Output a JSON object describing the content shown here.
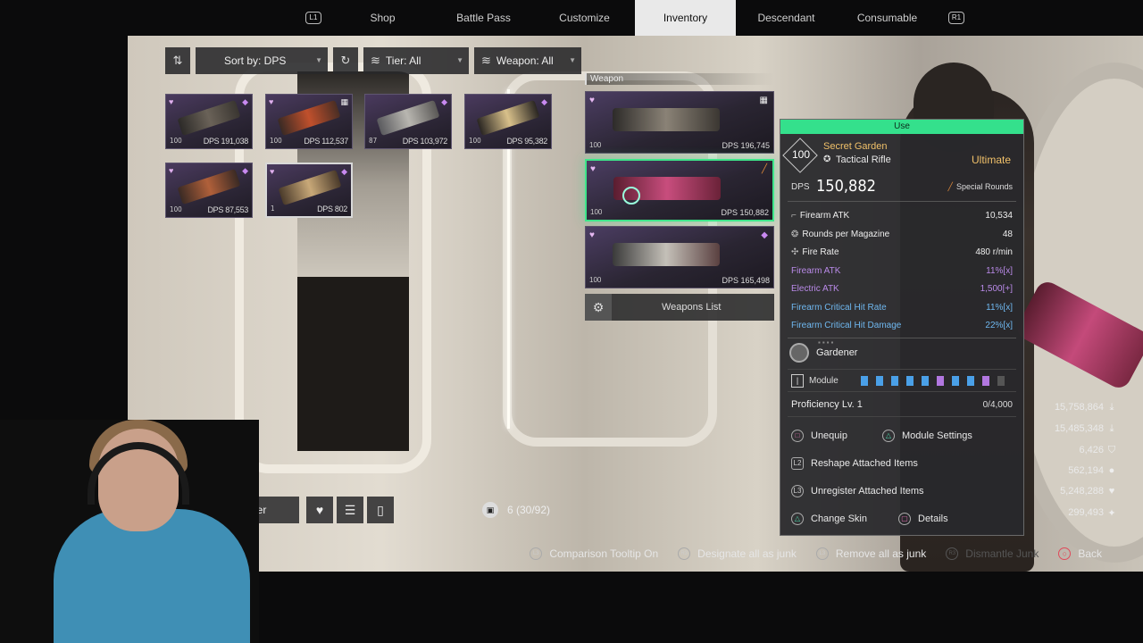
{
  "nav": {
    "left_hint": "L1",
    "right_hint": "R1",
    "tabs": [
      "Shop",
      "Battle Pass",
      "Customize",
      "Inventory",
      "Descendant",
      "Consumable"
    ],
    "active_tab": "Inventory"
  },
  "toolbar": {
    "sort_label": "Sort by: DPS",
    "tier_label": "Tier: All",
    "weapon_label": "Weapon: All"
  },
  "grid": [
    {
      "level": "100",
      "dps": "DPS 191,038",
      "tag": "purple"
    },
    {
      "level": "100",
      "dps": "DPS 112,537",
      "tag": "white"
    },
    {
      "level": "87",
      "dps": "DPS 103,972",
      "tag": "purple"
    },
    {
      "level": "100",
      "dps": "DPS 95,382",
      "tag": "purple"
    },
    {
      "level": "100",
      "dps": "DPS 87,553",
      "tag": "purple"
    },
    {
      "level": "1",
      "dps": "DPS 802",
      "tag": "purple"
    }
  ],
  "equipped": {
    "title": "Weapon",
    "slots": [
      {
        "level": "100",
        "dps": "DPS 196,745"
      },
      {
        "level": "100",
        "dps": "DPS 150,882"
      },
      {
        "level": "100",
        "dps": "DPS 165,498"
      }
    ],
    "weapons_list_label": "Weapons List"
  },
  "detail": {
    "use_label": "Use",
    "tier": "100",
    "name": "Secret Garden",
    "type": "Tactical Rifle",
    "rarity": "Ultimate",
    "dps_label": "DPS",
    "dps_value": "150,882",
    "ammo": "Special Rounds",
    "stats": [
      {
        "label": "Firearm ATK",
        "value": "10,534"
      },
      {
        "label": "Rounds per Magazine",
        "value": "48"
      },
      {
        "label": "Fire Rate",
        "value": "480 r/min"
      }
    ],
    "substats": [
      {
        "label": "Firearm ATK",
        "value": "11%[x]",
        "color": "purple"
      },
      {
        "label": "Electric ATK",
        "value": "1,500[+]",
        "color": "purple"
      },
      {
        "label": "Firearm Critical Hit Rate",
        "value": "11%[x]",
        "color": "blue"
      },
      {
        "label": "Firearm Critical Hit Damage",
        "value": "22%[x]",
        "color": "blue"
      }
    ],
    "skin_name": "Gardener",
    "module_label": "Module",
    "module_slots": [
      "b",
      "b",
      "b",
      "b",
      "b",
      "p",
      "b",
      "b",
      "p",
      "e"
    ],
    "proficiency_label": "Proficiency Lv. 1",
    "proficiency_value": "0/4,000",
    "actions": {
      "unequip": "Unequip",
      "module_settings": "Module Settings",
      "reshape": "Reshape Attached Items",
      "unregister": "Unregister Attached Items",
      "change_skin": "Change Skin",
      "details": "Details"
    }
  },
  "side_stats": [
    {
      "value": "15,758,864",
      "icon": "arrow-icon"
    },
    {
      "value": "15,485,348",
      "icon": "arrow-icon"
    },
    {
      "value": "6,426",
      "icon": "shield-icon"
    },
    {
      "value": "562,194",
      "icon": "circle-icon"
    },
    {
      "value": "5,248,288",
      "icon": "heart-icon"
    },
    {
      "value": "299,493",
      "icon": "star-icon"
    }
  ],
  "bottom": {
    "junk_filter": "Junk Filter",
    "inventory_count": "6 (30/92)"
  },
  "hints": [
    {
      "btn": "L3",
      "label": "Comparison Tooltip On",
      "dim": false
    },
    {
      "btn": "R3",
      "label": "Designate all as junk",
      "dim": false
    },
    {
      "btn": "L3",
      "label": "Remove all as junk",
      "dim": false
    },
    {
      "btn": "R3",
      "label": "Dismantle Junk",
      "dim": true
    },
    {
      "btn": "○",
      "label": "Back",
      "dim": false
    }
  ],
  "colors": {
    "accent_green": "#34e08c",
    "rarity_gold": "#f0c069",
    "substat_purple": "#b98ae8",
    "substat_blue": "#6fb8f0"
  }
}
